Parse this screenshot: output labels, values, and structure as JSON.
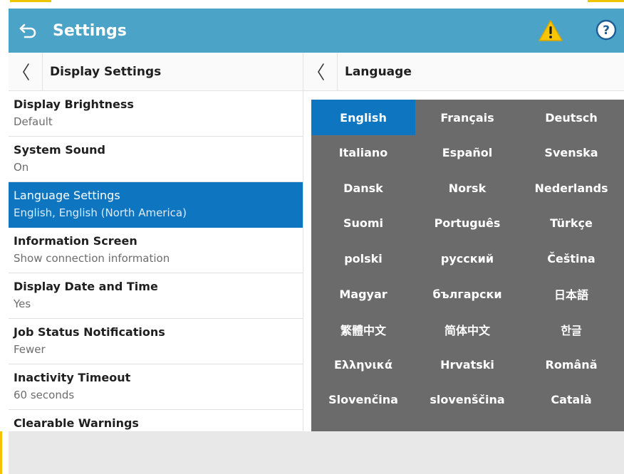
{
  "header": {
    "title": "Settings",
    "back_icon": "back-arrow-icon",
    "warning_icon": "warning-icon",
    "help_icon": "help-icon",
    "color": "#4ba3c7"
  },
  "left_panel": {
    "title": "Display Settings",
    "items": [
      {
        "label": "Display Brightness",
        "value": "Default"
      },
      {
        "label": "System Sound",
        "value": "On"
      },
      {
        "label": "Language Settings",
        "value": "English, English (North America)",
        "selected": true
      },
      {
        "label": "Information Screen",
        "value": "Show connection information"
      },
      {
        "label": "Display Date and Time",
        "value": "Yes"
      },
      {
        "label": "Job Status Notifications",
        "value": "Fewer"
      },
      {
        "label": "Inactivity Timeout",
        "value": "60 seconds"
      },
      {
        "label": "Clearable Warnings",
        "value": ""
      }
    ]
  },
  "right_panel": {
    "title": "Language",
    "selected": "English",
    "languages": [
      "English",
      "Français",
      "Deutsch",
      "Italiano",
      "Español",
      "Svenska",
      "Dansk",
      "Norsk",
      "Nederlands",
      "Suomi",
      "Português",
      "Türkçe",
      "polski",
      "русский",
      "Čeština",
      "Magyar",
      "български",
      "日本語",
      "繁體中文",
      "简体中文",
      "한글",
      "Ελληνικά",
      "Hrvatski",
      "Română",
      "Slovenčina",
      "slovenščina",
      "Català"
    ]
  },
  "colors": {
    "accent": "#f2c400",
    "selected": "#0e76c0",
    "grid": "#6b6b6b"
  }
}
